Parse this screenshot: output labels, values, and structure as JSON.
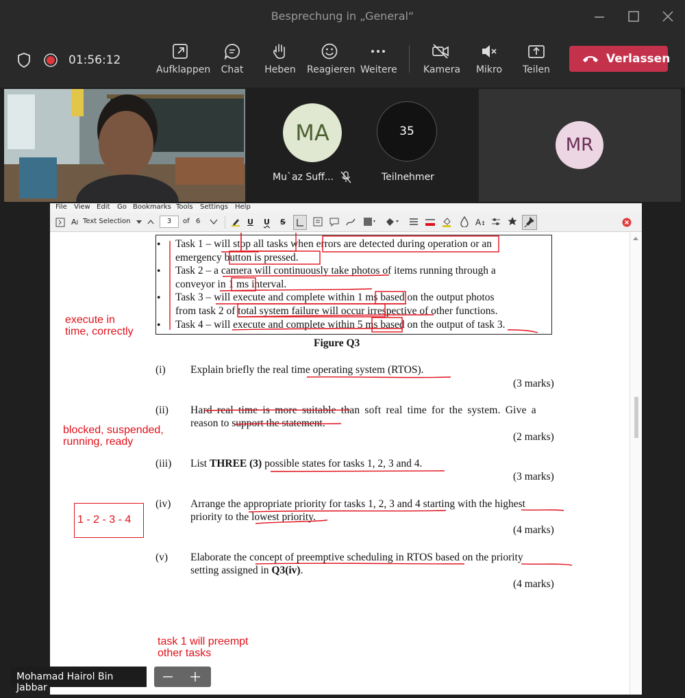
{
  "window": {
    "title": "Besprechung in „General“"
  },
  "meeting_toolbar": {
    "timer": "01:56:12",
    "buttons": [
      {
        "label": "Aufklappen",
        "icon": "pop-out-icon"
      },
      {
        "label": "Chat",
        "icon": "chat-icon"
      },
      {
        "label": "Heben",
        "icon": "raise-hand-icon"
      },
      {
        "label": "Reagieren",
        "icon": "smiley-icon"
      },
      {
        "label": "Weitere",
        "icon": "more-icon"
      },
      {
        "label": "Kamera",
        "icon": "camera-off-icon"
      },
      {
        "label": "Mikro",
        "icon": "mic-muted-icon"
      },
      {
        "label": "Teilen",
        "icon": "share-icon"
      }
    ],
    "leave_label": "Verlassen",
    "colors": {
      "leave": "#c4314b",
      "background": "#292929"
    }
  },
  "participants": {
    "ma_initials": "MA",
    "ma_name": "Mu`az Suff...",
    "count": "35",
    "count_label": "Teilnehmer",
    "mr_initials": "MR"
  },
  "viewer": {
    "menu": [
      "File",
      "View",
      "Edit",
      "Go",
      "Bookmarks",
      "Tools",
      "Settings",
      "Help"
    ],
    "mode_label": "Text Selection",
    "page_current": "3",
    "page_of": "of",
    "page_total": "6"
  },
  "document": {
    "bullets": [
      "Task 1 – will stop all tasks when errors are detected during operation or an",
      "emergency button is pressed.",
      "Task 2 – a camera will continuously take photos of items running through a",
      "conveyor in 1 ms interval.",
      "Task 3 – will execute and complete within 1 ms based on the output photos",
      "from task 2 of total system failure will occur irrespective of other functions.",
      "Task 4 – will execute and complete within 5 ms based on the output of task 3."
    ],
    "bullet_symbol": "•",
    "figure_caption": "Figure Q3",
    "questions": [
      {
        "num": "(i)",
        "lines": [
          "Explain briefly the real time operating system (RTOS)."
        ],
        "marks": "(3 marks)"
      },
      {
        "num": "(ii)",
        "lines": [
          "Hard real time is more suitable than soft real time for the system. Give a",
          "reason to support the statement."
        ],
        "marks": "(2 marks)"
      },
      {
        "num": "(iii)",
        "pre": "List ",
        "bold": "THREE (3)",
        "post": " possible states for tasks 1, 2, 3 and 4.",
        "marks": "(3 marks)"
      },
      {
        "num": "(iv)",
        "lines": [
          "Arrange the appropriate priority for tasks 1, 2, 3 and 4 starting with the highest",
          "priority to the lowest priority."
        ],
        "marks": "(4 marks)"
      },
      {
        "num": "(v)",
        "line1": "Elaborate the concept of preemptive scheduling in RTOS based on the priority",
        "line2_pre": "setting assigned in ",
        "line2_bold": "Q3(iv)",
        "line2_post": ".",
        "marks": "(4 marks)"
      }
    ]
  },
  "annotations": {
    "a1": [
      "execute in",
      "time, correctly"
    ],
    "a2": [
      "blocked, suspended,",
      "running, ready"
    ],
    "a3": "1 - 2 - 3 - 4",
    "a4": [
      "task 1 will preempt",
      "other tasks"
    ],
    "color": "#e0101a"
  },
  "presenter": {
    "name": "Mohamad Hairol Bin Jabbar"
  }
}
